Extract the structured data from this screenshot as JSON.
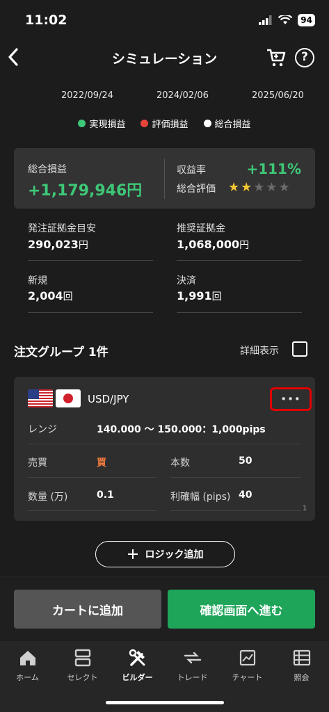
{
  "status_bar": {
    "time": "11:02",
    "battery": "94"
  },
  "header": {
    "title": "シミュレーション"
  },
  "timeline": {
    "dates": [
      "2022/09/24",
      "2024/02/06",
      "2025/06/20"
    ]
  },
  "legend": [
    {
      "label": "実現損益",
      "color": "#3ec777"
    },
    {
      "label": "評価損益",
      "color": "#e8443a"
    },
    {
      "label": "総合損益",
      "color": "#ffffff"
    }
  ],
  "summary": {
    "total_pl_label": "総合損益",
    "total_pl_value": "+1,179,946円",
    "return_label": "収益率",
    "return_value": "+111%",
    "rating_label": "総合評価",
    "rating_stars": 2,
    "rating_max": 5
  },
  "stats": {
    "order_margin_label": "発注証拠金目安",
    "order_margin_value": "290,023",
    "order_margin_unit": "円",
    "recommended_margin_label": "推奨証拠金",
    "recommended_margin_value": "1,068,000",
    "recommended_margin_unit": "円",
    "new_label": "新規",
    "new_value": "2,004",
    "new_unit": "回",
    "settle_label": "決済",
    "settle_value": "1,991",
    "settle_unit": "回"
  },
  "order_group": {
    "title": "注文グループ 1件",
    "detail_label": "詳細表示",
    "pair": "USD/JPY",
    "more_label": "•••",
    "range_label": "レンジ",
    "range_value": "140.000 〜 150.000：1,000pips",
    "trade_label": "売買",
    "trade_value": "買",
    "count_label": "本数",
    "count_value": "50",
    "qty_label": "数量 (万)",
    "qty_value": "0.1",
    "profit_label": "利確幅 (pips)",
    "profit_value": "40",
    "page": "1"
  },
  "add_logic_label": "ロジック追加",
  "actions": {
    "cart": "カートに追加",
    "confirm": "確認画面へ進む"
  },
  "tabs": [
    {
      "label": "ホーム",
      "icon": "home-icon"
    },
    {
      "label": "セレクト",
      "icon": "select-icon"
    },
    {
      "label": "ビルダー",
      "icon": "builder-icon"
    },
    {
      "label": "トレード",
      "icon": "trade-icon"
    },
    {
      "label": "チャート",
      "icon": "chart-icon"
    },
    {
      "label": "照会",
      "icon": "inquiry-icon"
    }
  ],
  "colors": {
    "accent_green": "#1fa55a",
    "positive": "#3ec777",
    "buy": "#f07b3f",
    "highlight_box": "#e00000"
  }
}
